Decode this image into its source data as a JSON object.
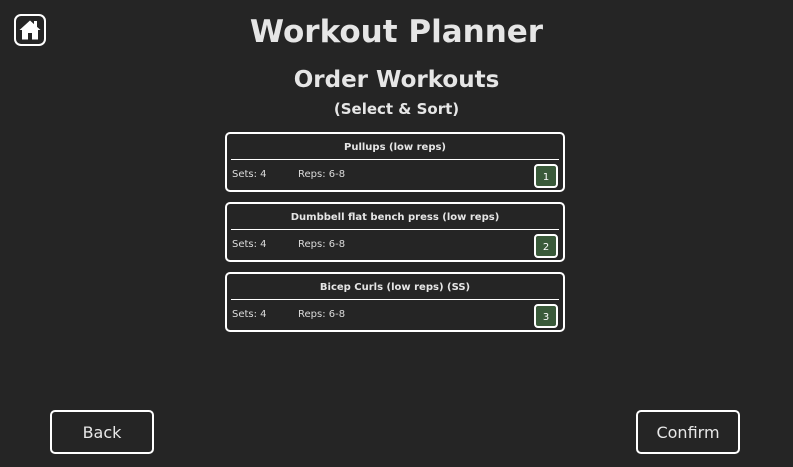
{
  "header": {
    "title": "Workout Planner",
    "home_icon": "home-icon"
  },
  "page": {
    "heading": "Order Workouts",
    "subheading": "(Select & Sort)"
  },
  "workouts": [
    {
      "name": "Pullups (low reps)",
      "sets": "Sets: 4",
      "reps": "Reps: 6-8",
      "order": "1"
    },
    {
      "name": "Dumbbell flat bench press (low reps)",
      "sets": "Sets: 4",
      "reps": "Reps: 6-8",
      "order": "2"
    },
    {
      "name": "Bicep Curls (low reps) (SS)",
      "sets": "Sets: 4",
      "reps": "Reps: 6-8",
      "order": "3"
    }
  ],
  "footer": {
    "back_label": "Back",
    "confirm_label": "Confirm"
  },
  "colors": {
    "background": "#252525",
    "border": "#ffffff",
    "badge_fill": "#3a5a3a",
    "text": "#e6e6e6"
  }
}
